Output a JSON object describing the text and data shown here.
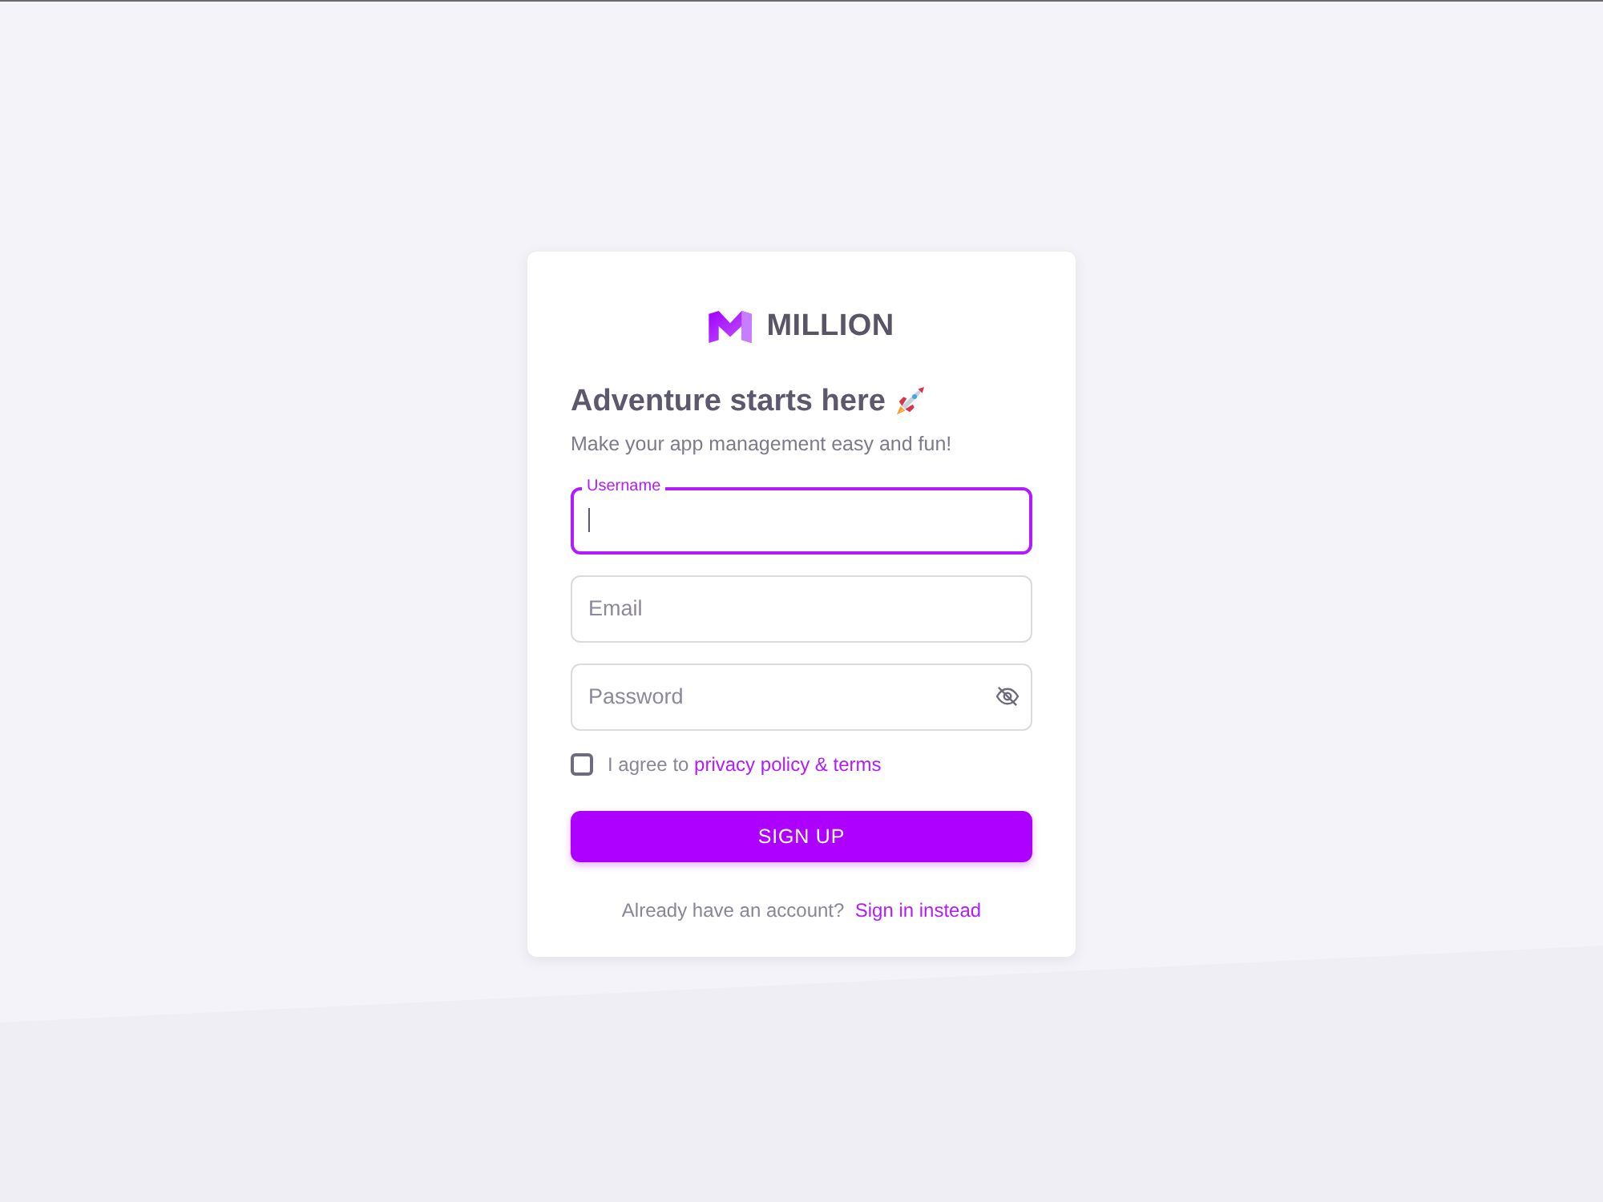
{
  "logo": {
    "name": "MILLION"
  },
  "heading": {
    "title": "Adventure starts here",
    "subtitle": "Make your app management easy and fun!"
  },
  "fields": [
    {
      "kind": "text",
      "label": "Username",
      "focused": true
    },
    {
      "kind": "text",
      "placeholder": "Email",
      "focused": false
    },
    {
      "kind": "password",
      "placeholder": "Password",
      "focused": false
    }
  ],
  "agreement": {
    "text": "I agree to",
    "link": "privacy policy & terms",
    "checked": false
  },
  "submit_button": {
    "label": "SIGN UP"
  },
  "footer": {
    "text": "Already have an account?",
    "link": "Sign in instead"
  }
}
